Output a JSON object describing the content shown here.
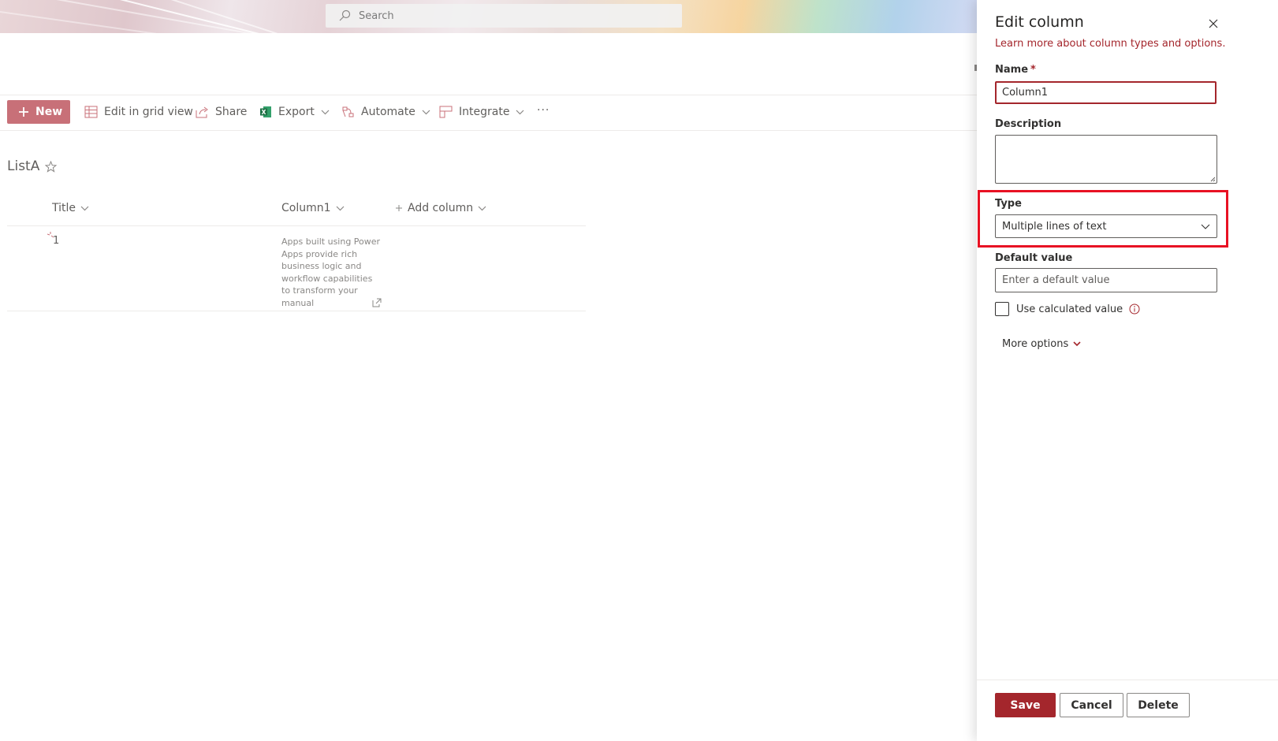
{
  "search": {
    "placeholder": "Search"
  },
  "toolbar": {
    "new_label": "New",
    "edit_grid_label": "Edit in grid view",
    "share_label": "Share",
    "export_label": "Export",
    "automate_label": "Automate",
    "integrate_label": "Integrate",
    "more_label": "···"
  },
  "list": {
    "title": "ListA",
    "columns": [
      "Title",
      "Column1",
      "Add column"
    ],
    "rows": [
      {
        "title": "1",
        "column1": "Apps built using Power Apps provide rich business logic and workflow capabilities to transform your manual"
      }
    ]
  },
  "panel": {
    "title": "Edit column",
    "learn_more": "Learn more about column types and options.",
    "name_label": "Name",
    "required_mark": "*",
    "name_value": "Column1",
    "description_label": "Description",
    "type_label": "Type",
    "type_value": "Multiple lines of text",
    "default_label": "Default value",
    "default_placeholder": "Enter a default value",
    "calculated_label": "Use calculated value",
    "more_options": "More options",
    "save": "Save",
    "cancel": "Cancel",
    "delete": "Delete"
  },
  "colors": {
    "accent": "#a4262c",
    "new_button": "#c87078",
    "highlight": "#e81123"
  }
}
